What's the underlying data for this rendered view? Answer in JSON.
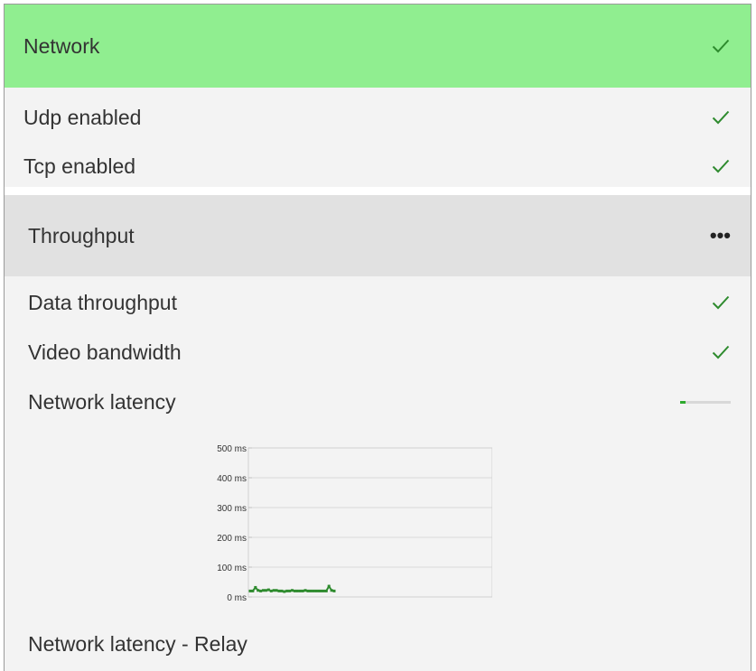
{
  "network": {
    "title": "Network",
    "status_icon": "check-icon",
    "items": [
      {
        "label": "Udp enabled",
        "status_icon": "check-icon"
      },
      {
        "label": "Tcp enabled",
        "status_icon": "check-icon"
      }
    ]
  },
  "throughput": {
    "title": "Throughput",
    "status_icon": "ellipsis-icon",
    "items": [
      {
        "label": "Data throughput",
        "status_icon": "check-icon"
      },
      {
        "label": "Video bandwidth",
        "status_icon": "check-icon"
      },
      {
        "label": "Network latency",
        "status_icon": "progress-bar",
        "progress": 0.1
      },
      {
        "label": "Network latency - Relay"
      }
    ]
  },
  "colors": {
    "network_header_bg": "#90ee90",
    "throughput_header_bg": "#e1e1e1",
    "body_bg": "#f3f3f3",
    "check": "#2e8b2e",
    "latency_line": "#2e8b2e"
  },
  "chart_data": {
    "type": "line",
    "title": "",
    "xlabel": "",
    "ylabel": "",
    "ylim": [
      0,
      500
    ],
    "y_ticks": [
      "0 ms",
      "100 ms",
      "200 ms",
      "300 ms",
      "400 ms",
      "500 ms"
    ],
    "grid": true,
    "series": [
      {
        "color": "#2e8b2e",
        "values": [
          20,
          20,
          32,
          22,
          20,
          22,
          22,
          24,
          20,
          22,
          22,
          20,
          20,
          18,
          20,
          20,
          22,
          20,
          20,
          20,
          20,
          22,
          20,
          20,
          20,
          20,
          20,
          20,
          20,
          20,
          36,
          22,
          20
        ]
      }
    ]
  }
}
